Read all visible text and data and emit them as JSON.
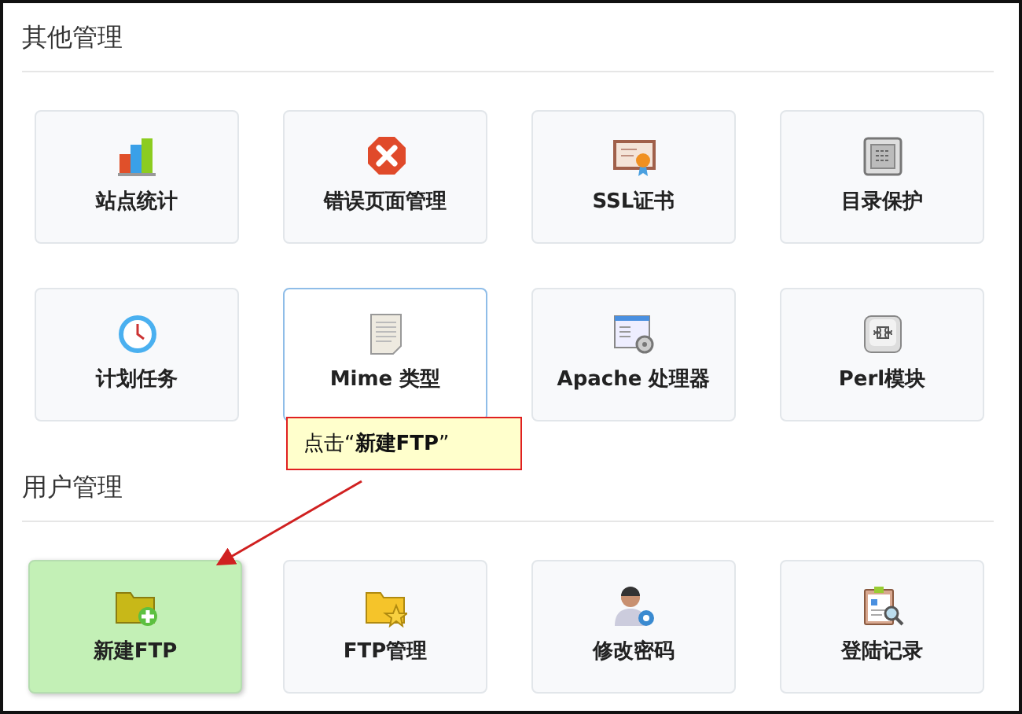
{
  "sections": [
    {
      "title": "其他管理",
      "tiles": [
        {
          "label": "站点统计",
          "highlighted": false,
          "hovered": false
        },
        {
          "label": "错误页面管理",
          "highlighted": false,
          "hovered": false
        },
        {
          "label": "SSL证书",
          "highlighted": false,
          "hovered": false
        },
        {
          "label": "目录保护",
          "highlighted": false,
          "hovered": false
        },
        {
          "label": "计划任务",
          "highlighted": false,
          "hovered": false
        },
        {
          "label": "Mime 类型",
          "highlighted": false,
          "hovered": true
        },
        {
          "label": "Apache 处理器",
          "highlighted": false,
          "hovered": false
        },
        {
          "label": "Perl模块",
          "highlighted": false,
          "hovered": false
        }
      ]
    },
    {
      "title": "用户管理",
      "tiles": [
        {
          "label": "新建FTP",
          "highlighted": true,
          "hovered": false
        },
        {
          "label": "FTP管理",
          "highlighted": false,
          "hovered": false
        },
        {
          "label": "修改密码",
          "highlighted": false,
          "hovered": false
        },
        {
          "label": "登陆记录",
          "highlighted": false,
          "hovered": false
        }
      ]
    }
  ],
  "callout": {
    "text": "点击“**新建FTP**”"
  }
}
